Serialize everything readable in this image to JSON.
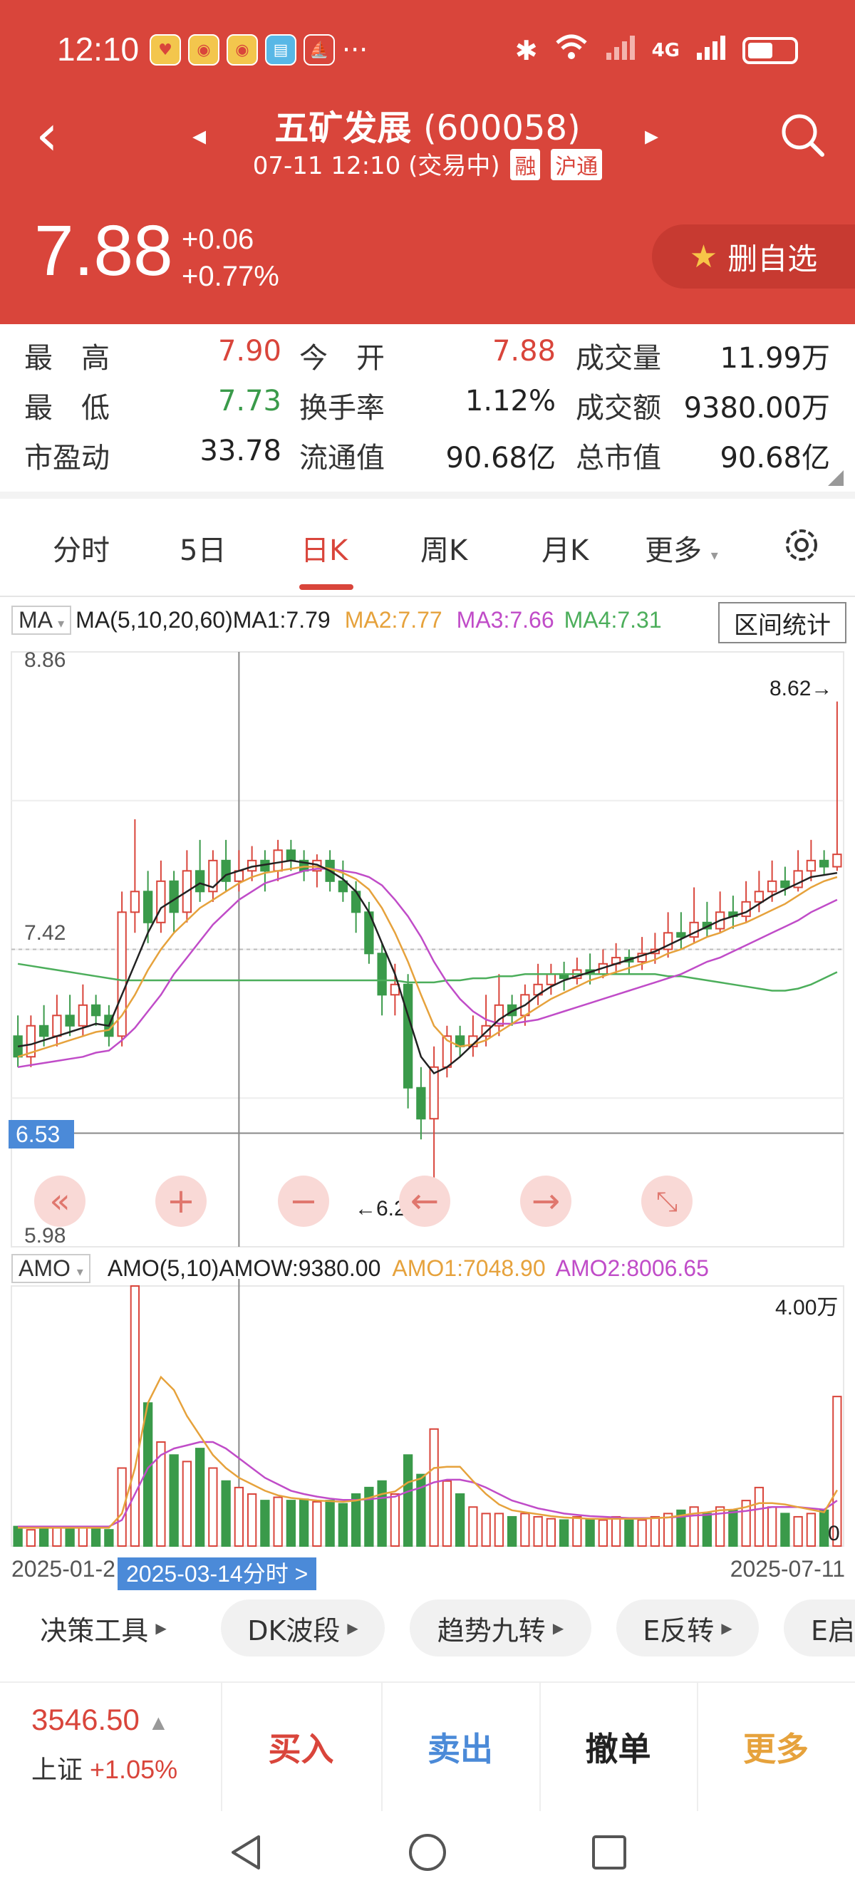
{
  "status_bar": {
    "time": "12:10",
    "dots": "···",
    "network": "4G"
  },
  "header": {
    "stock_name": "五矿发展",
    "stock_code": "(600058)",
    "datetime": "07-11 12:10",
    "trade_status": "(交易中)",
    "tag_margin": "融",
    "tag_connect": "沪通",
    "price": "7.88",
    "change_abs": "+0.06",
    "change_pct": "+0.77%",
    "watch_button": "删自选"
  },
  "stats": {
    "high_label": "最　高",
    "high": "7.90",
    "open_label": "今　开",
    "open": "7.88",
    "volume_label": "成交量",
    "volume": "11.99万",
    "low_label": "最　低",
    "low": "7.73",
    "turnover_label": "换手率",
    "turnover": "1.12%",
    "amount_label": "成交额",
    "amount": "9380.00万",
    "pe_label": "市盈动",
    "pe": "33.78",
    "float_cap_label": "流通值",
    "float_cap": "90.68亿",
    "total_cap_label": "总市值",
    "total_cap": "90.68亿"
  },
  "tabs": [
    "分时",
    "5日",
    "日K",
    "周K",
    "月K",
    "更多"
  ],
  "active_tab": "日K",
  "indicator": {
    "select": "MA",
    "params": "MA(5,10,20,60)",
    "ma1": "MA1:7.79",
    "ma2": "MA2:7.77",
    "ma3": "MA3:7.66",
    "ma4": "MA4:7.31"
  },
  "range_stats_button": "区间统计",
  "axis": {
    "top": "8.86",
    "mid": "7.42",
    "bottom": "5.98",
    "crosshair_price": "6.53",
    "max_marker": "8.62→",
    "min_marker": "←6.22"
  },
  "volume_indicator": {
    "select": "AMO",
    "params": "AMO(5,10)",
    "amow": "AMOW:9380.00",
    "amo1": "AMO1:7048.90",
    "amo2": "AMO2:8006.65",
    "max_label": "4.00万",
    "zero_label": "0"
  },
  "dates": {
    "start": "2025-01-2",
    "end": "2025-07-11",
    "selected": "2025-03-14分时 >"
  },
  "tools": [
    "决策工具",
    "DK波段",
    "趋势九转",
    "E反转",
    "E启"
  ],
  "index": {
    "value": "3546.50",
    "name": "上证",
    "change": "+1.05%"
  },
  "actions": {
    "buy": "买入",
    "sell": "卖出",
    "cancel": "撤单",
    "more": "更多"
  },
  "colors": {
    "header": "#d9453b",
    "up": "#d9453b",
    "down": "#3a9a4a",
    "ma1": "#222222",
    "ma2": "#e6a23c",
    "ma3": "#c04cc8",
    "ma4": "#4cae5b",
    "accent_blue": "#4b8ad8"
  },
  "chart_data": {
    "type": "candlestick",
    "price_axis": [
      5.98,
      8.86
    ],
    "highlight_levels": [
      7.42,
      6.53
    ],
    "candles": [
      [
        7.0,
        6.9,
        7.1,
        6.85
      ],
      [
        6.9,
        7.05,
        7.1,
        6.85
      ],
      [
        7.05,
        7.0,
        7.15,
        6.95
      ],
      [
        7.0,
        7.1,
        7.2,
        6.95
      ],
      [
        7.1,
        7.05,
        7.2,
        7.0
      ],
      [
        7.05,
        7.15,
        7.25,
        7.0
      ],
      [
        7.15,
        7.1,
        7.2,
        7.05
      ],
      [
        7.1,
        7.0,
        7.15,
        6.95
      ],
      [
        7.0,
        7.6,
        7.7,
        6.95
      ],
      [
        7.6,
        7.7,
        8.05,
        7.5
      ],
      [
        7.7,
        7.55,
        7.8,
        7.45
      ],
      [
        7.55,
        7.75,
        7.85,
        7.5
      ],
      [
        7.75,
        7.6,
        7.8,
        7.5
      ],
      [
        7.6,
        7.8,
        7.9,
        7.55
      ],
      [
        7.8,
        7.7,
        7.95,
        7.65
      ],
      [
        7.7,
        7.85,
        7.9,
        7.65
      ],
      [
        7.85,
        7.75,
        7.95,
        7.7
      ],
      [
        7.75,
        7.8,
        7.9,
        7.7
      ],
      [
        7.8,
        7.85,
        7.92,
        7.75
      ],
      [
        7.85,
        7.8,
        7.9,
        7.7
      ],
      [
        7.8,
        7.9,
        7.95,
        7.75
      ],
      [
        7.9,
        7.85,
        7.95,
        7.8
      ],
      [
        7.85,
        7.8,
        7.9,
        7.75
      ],
      [
        7.8,
        7.85,
        7.88,
        7.72
      ],
      [
        7.85,
        7.75,
        7.9,
        7.7
      ],
      [
        7.75,
        7.7,
        7.85,
        7.65
      ],
      [
        7.7,
        7.6,
        7.75,
        7.5
      ],
      [
        7.6,
        7.4,
        7.65,
        7.35
      ],
      [
        7.4,
        7.2,
        7.45,
        7.1
      ],
      [
        7.2,
        7.25,
        7.35,
        7.1
      ],
      [
        7.25,
        6.75,
        7.3,
        6.65
      ],
      [
        6.75,
        6.6,
        6.85,
        6.5
      ],
      [
        6.6,
        6.85,
        6.95,
        6.22
      ],
      [
        6.85,
        7.0,
        7.05,
        6.8
      ],
      [
        7.0,
        6.95,
        7.05,
        6.9
      ],
      [
        6.95,
        7.0,
        7.1,
        6.9
      ],
      [
        7.0,
        7.05,
        7.2,
        6.95
      ],
      [
        7.05,
        7.15,
        7.3,
        7.0
      ],
      [
        7.15,
        7.1,
        7.2,
        7.05
      ],
      [
        7.1,
        7.2,
        7.25,
        7.05
      ],
      [
        7.2,
        7.25,
        7.35,
        7.15
      ],
      [
        7.25,
        7.3,
        7.35,
        7.2
      ],
      [
        7.3,
        7.28,
        7.36,
        7.22
      ],
      [
        7.28,
        7.32,
        7.38,
        7.25
      ],
      [
        7.32,
        7.3,
        7.4,
        7.25
      ],
      [
        7.3,
        7.35,
        7.42,
        7.28
      ],
      [
        7.35,
        7.38,
        7.45,
        7.3
      ],
      [
        7.38,
        7.36,
        7.42,
        7.3
      ],
      [
        7.36,
        7.4,
        7.48,
        7.32
      ],
      [
        7.4,
        7.42,
        7.5,
        7.35
      ],
      [
        7.42,
        7.5,
        7.6,
        7.38
      ],
      [
        7.5,
        7.48,
        7.6,
        7.42
      ],
      [
        7.48,
        7.55,
        7.72,
        7.45
      ],
      [
        7.55,
        7.52,
        7.65,
        7.48
      ],
      [
        7.52,
        7.6,
        7.7,
        7.5
      ],
      [
        7.6,
        7.58,
        7.68,
        7.52
      ],
      [
        7.58,
        7.65,
        7.75,
        7.55
      ],
      [
        7.65,
        7.7,
        7.8,
        7.6
      ],
      [
        7.7,
        7.75,
        7.85,
        7.65
      ],
      [
        7.75,
        7.72,
        7.82,
        7.68
      ],
      [
        7.72,
        7.8,
        7.9,
        7.7
      ],
      [
        7.8,
        7.85,
        7.95,
        7.75
      ],
      [
        7.85,
        7.82,
        7.9,
        7.78
      ],
      [
        7.82,
        7.88,
        8.62,
        7.8
      ]
    ],
    "ma1": [
      6.95,
      6.96,
      6.98,
      7.0,
      7.02,
      7.04,
      7.06,
      7.05,
      7.2,
      7.35,
      7.5,
      7.62,
      7.66,
      7.7,
      7.74,
      7.72,
      7.78,
      7.8,
      7.82,
      7.83,
      7.84,
      7.85,
      7.84,
      7.83,
      7.8,
      7.76,
      7.7,
      7.6,
      7.45,
      7.3,
      7.1,
      6.9,
      6.82,
      6.85,
      6.9,
      6.96,
      7.02,
      7.08,
      7.12,
      7.15,
      7.2,
      7.24,
      7.27,
      7.29,
      7.31,
      7.33,
      7.35,
      7.37,
      7.39,
      7.41,
      7.44,
      7.47,
      7.5,
      7.53,
      7.56,
      7.58,
      7.6,
      7.64,
      7.68,
      7.71,
      7.74,
      7.77,
      7.78,
      7.79
    ],
    "ma2": [
      6.9,
      6.92,
      6.94,
      6.96,
      6.98,
      7.0,
      7.02,
      7.03,
      7.1,
      7.2,
      7.32,
      7.42,
      7.5,
      7.56,
      7.62,
      7.66,
      7.7,
      7.74,
      7.77,
      7.79,
      7.8,
      7.81,
      7.82,
      7.82,
      7.81,
      7.79,
      7.76,
      7.71,
      7.62,
      7.5,
      7.36,
      7.2,
      7.05,
      6.98,
      6.95,
      6.96,
      6.98,
      7.02,
      7.06,
      7.1,
      7.14,
      7.18,
      7.21,
      7.24,
      7.27,
      7.29,
      7.31,
      7.33,
      7.35,
      7.37,
      7.4,
      7.42,
      7.45,
      7.48,
      7.5,
      7.53,
      7.55,
      7.58,
      7.61,
      7.64,
      7.68,
      7.72,
      7.75,
      7.77
    ],
    "ma3": [
      6.85,
      6.86,
      6.87,
      6.88,
      6.89,
      6.9,
      6.92,
      6.93,
      6.98,
      7.04,
      7.12,
      7.2,
      7.3,
      7.38,
      7.46,
      7.54,
      7.6,
      7.66,
      7.7,
      7.74,
      7.76,
      7.78,
      7.8,
      7.81,
      7.81,
      7.8,
      7.79,
      7.77,
      7.73,
      7.66,
      7.58,
      7.48,
      7.36,
      7.26,
      7.18,
      7.12,
      7.08,
      7.06,
      7.06,
      7.07,
      7.08,
      7.1,
      7.12,
      7.14,
      7.16,
      7.18,
      7.2,
      7.22,
      7.24,
      7.26,
      7.28,
      7.3,
      7.33,
      7.36,
      7.38,
      7.41,
      7.44,
      7.47,
      7.5,
      7.53,
      7.56,
      7.6,
      7.63,
      7.66
    ],
    "ma4": [
      7.35,
      7.34,
      7.33,
      7.32,
      7.31,
      7.3,
      7.29,
      7.28,
      7.27,
      7.27,
      7.27,
      7.27,
      7.27,
      7.27,
      7.27,
      7.27,
      7.27,
      7.27,
      7.27,
      7.27,
      7.27,
      7.27,
      7.27,
      7.27,
      7.27,
      7.27,
      7.27,
      7.27,
      7.27,
      7.27,
      7.26,
      7.26,
      7.26,
      7.27,
      7.27,
      7.28,
      7.28,
      7.29,
      7.29,
      7.3,
      7.3,
      7.3,
      7.3,
      7.3,
      7.3,
      7.3,
      7.3,
      7.3,
      7.3,
      7.3,
      7.29,
      7.29,
      7.28,
      7.27,
      7.26,
      7.25,
      7.24,
      7.23,
      7.22,
      7.22,
      7.23,
      7.25,
      7.28,
      7.31
    ],
    "volume": [
      0.3,
      0.25,
      0.28,
      0.3,
      0.26,
      0.28,
      0.27,
      0.25,
      1.2,
      4.0,
      2.2,
      1.6,
      1.4,
      1.3,
      1.5,
      1.2,
      1.0,
      0.9,
      0.8,
      0.7,
      0.75,
      0.7,
      0.72,
      0.68,
      0.7,
      0.65,
      0.8,
      0.9,
      1.0,
      0.8,
      1.4,
      1.1,
      1.8,
      1.0,
      0.8,
      0.6,
      0.5,
      0.5,
      0.45,
      0.5,
      0.45,
      0.42,
      0.4,
      0.45,
      0.42,
      0.4,
      0.45,
      0.42,
      0.4,
      0.45,
      0.5,
      0.55,
      0.6,
      0.5,
      0.6,
      0.55,
      0.7,
      0.9,
      0.6,
      0.5,
      0.45,
      0.5,
      0.55,
      2.3
    ],
    "amo1": [
      0.28,
      0.28,
      0.28,
      0.28,
      0.28,
      0.28,
      0.28,
      0.28,
      0.5,
      1.2,
      2.2,
      2.6,
      2.4,
      2.0,
      1.7,
      1.4,
      1.2,
      1.05,
      0.95,
      0.85,
      0.78,
      0.74,
      0.72,
      0.7,
      0.69,
      0.68,
      0.7,
      0.74,
      0.8,
      0.84,
      0.98,
      1.04,
      1.2,
      1.22,
      1.22,
      1.0,
      0.8,
      0.64,
      0.55,
      0.52,
      0.49,
      0.46,
      0.44,
      0.43,
      0.42,
      0.42,
      0.42,
      0.42,
      0.42,
      0.43,
      0.44,
      0.47,
      0.5,
      0.52,
      0.55,
      0.56,
      0.6,
      0.66,
      0.66,
      0.64,
      0.6,
      0.56,
      0.52,
      0.86
    ],
    "amo2": [
      0.3,
      0.3,
      0.3,
      0.3,
      0.3,
      0.3,
      0.3,
      0.3,
      0.4,
      0.8,
      1.2,
      1.4,
      1.5,
      1.55,
      1.6,
      1.6,
      1.5,
      1.35,
      1.2,
      1.05,
      0.95,
      0.85,
      0.8,
      0.76,
      0.73,
      0.71,
      0.71,
      0.72,
      0.74,
      0.76,
      0.84,
      0.9,
      0.98,
      1.02,
      1.02,
      0.98,
      0.9,
      0.8,
      0.7,
      0.64,
      0.58,
      0.54,
      0.5,
      0.48,
      0.46,
      0.45,
      0.44,
      0.43,
      0.43,
      0.43,
      0.44,
      0.45,
      0.47,
      0.48,
      0.5,
      0.52,
      0.54,
      0.57,
      0.6,
      0.6,
      0.6,
      0.58,
      0.56,
      0.7
    ],
    "volume_axis": [
      0,
      4.0
    ]
  }
}
